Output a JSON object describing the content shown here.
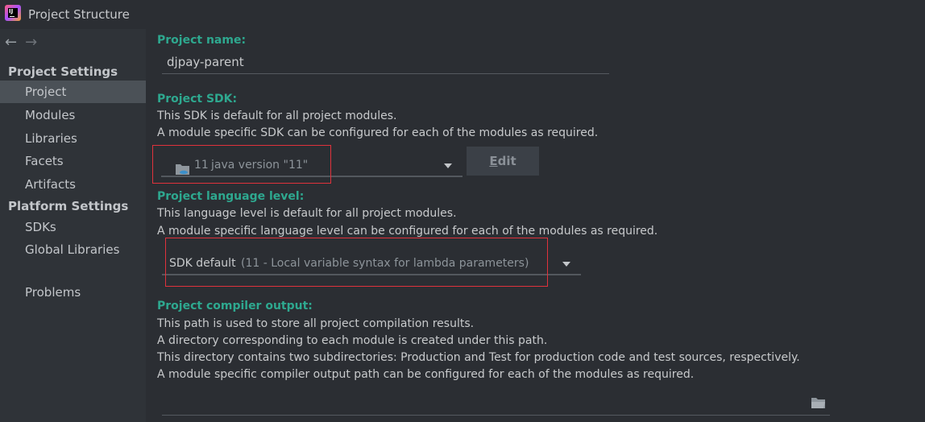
{
  "window": {
    "title": "Project Structure",
    "logo_text": "IJ"
  },
  "sidebar": {
    "nav_back": "←",
    "nav_forward": "→",
    "project_settings_header": "Project Settings",
    "project_settings_items": [
      "Project",
      "Modules",
      "Libraries",
      "Facets",
      "Artifacts"
    ],
    "selected_item": "Project",
    "platform_settings_header": "Platform Settings",
    "platform_settings_items": [
      "SDKs",
      "Global Libraries"
    ],
    "problems_item": "Problems"
  },
  "main": {
    "project_name": {
      "label": "Project name:",
      "value": "djpay-parent"
    },
    "project_sdk": {
      "label": "Project SDK:",
      "desc1": "This SDK is default for all project modules.",
      "desc2": "A module specific SDK can be configured for each of the modules as required.",
      "selected_prefix": "11",
      "selected_suffix": "java version \"11\"",
      "edit_label_first": "E",
      "edit_label_rest": "dit"
    },
    "language_level": {
      "label": "Project language level:",
      "desc1": "This language level is default for all project modules.",
      "desc2": "A module specific language level can be configured for each of the modules as required.",
      "selected_main": "SDK default",
      "selected_detail": "(11 - Local variable syntax for lambda parameters)"
    },
    "compiler_output": {
      "label": "Project compiler output:",
      "desc1": "This path is used to store all project compilation results.",
      "desc2": "A directory corresponding to each module is created under this path.",
      "desc3": "This directory contains two subdirectories: Production and Test for production code and test sources, respectively.",
      "desc4": "A module specific compiler output path can be configured for each of the modules as required.",
      "value": ""
    }
  },
  "colors": {
    "accent_label": "#2ea88f",
    "highlight_box": "#e0323c",
    "selected_row": "#4b5157"
  }
}
